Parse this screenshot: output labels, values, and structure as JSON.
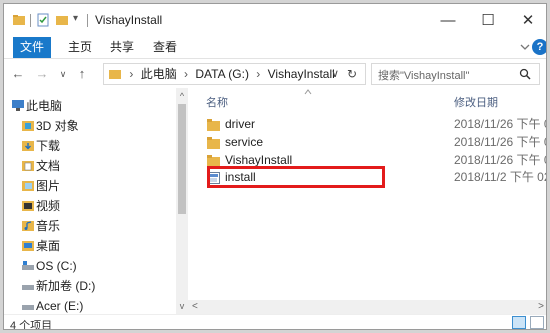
{
  "window": {
    "title": "VishayInstall",
    "controls": {
      "minimize": "—",
      "maximize": "☐",
      "close": "✕"
    }
  },
  "ribbon": {
    "tabs": [
      "文件",
      "主页",
      "共享",
      "查看"
    ],
    "help": "?"
  },
  "address": {
    "crumbs": [
      "此电脑",
      "DATA (G:)",
      "VishayInstall"
    ],
    "dropdown": "∨",
    "refresh": "↻"
  },
  "search": {
    "placeholder": "搜索\"VishayInstall\""
  },
  "nav_pane": {
    "items": [
      {
        "label": "此电脑",
        "icon": "pc-icon"
      },
      {
        "label": "3D 对象",
        "icon": "3d-objects-icon"
      },
      {
        "label": "下载",
        "icon": "download-folder-icon"
      },
      {
        "label": "文档",
        "icon": "documents-folder-icon"
      },
      {
        "label": "图片",
        "icon": "pictures-folder-icon"
      },
      {
        "label": "视频",
        "icon": "videos-folder-icon"
      },
      {
        "label": "音乐",
        "icon": "music-folder-icon"
      },
      {
        "label": "桌面",
        "icon": "desktop-folder-icon"
      },
      {
        "label": "OS (C:)",
        "icon": "system-drive-icon"
      },
      {
        "label": "新加卷 (D:)",
        "icon": "drive-icon"
      },
      {
        "label": "Acer (E:)",
        "icon": "drive-icon"
      }
    ]
  },
  "file_list": {
    "columns": {
      "name": "名称",
      "modified": "修改日期"
    },
    "rows": [
      {
        "name": "driver",
        "modified": "2018/11/26 下午 0...",
        "type": "folder"
      },
      {
        "name": "service",
        "modified": "2018/11/26 下午 0...",
        "type": "folder"
      },
      {
        "name": "VishayInstall",
        "modified": "2018/11/26 下午 0...",
        "type": "folder"
      },
      {
        "name": "install",
        "modified": "2018/11/2 下午 02:...",
        "type": "file"
      }
    ]
  },
  "status": {
    "item_count": "4 个项目"
  },
  "colors": {
    "accent": "#1979ca",
    "highlight": "#e31b1b",
    "folder": "#e8b64a"
  }
}
